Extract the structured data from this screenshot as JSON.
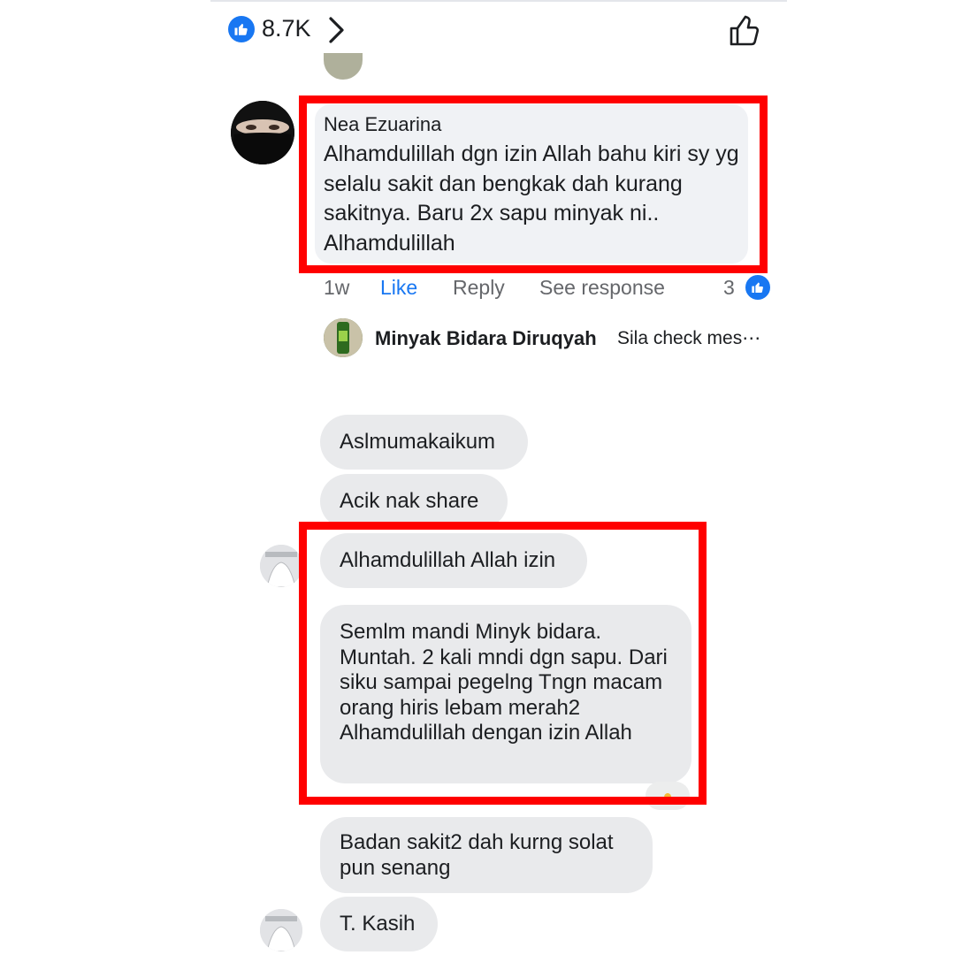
{
  "reactions": {
    "count": "8.7K",
    "icons": {
      "badge": "like-thumb-icon",
      "chevron": "chevron-right-icon",
      "action": "thumbs-up-outline-icon"
    }
  },
  "comment": {
    "author": "Nea Ezuarina",
    "text": "Alhamdulillah dgn izin Allah bahu kiri sy yg selalu sakit dan bengkak dah kurang sakitnya. Baru 2x sapu minyak ni.. Alhamdulillah",
    "time": "1w",
    "like_label": "Like",
    "reply_label": "Reply",
    "see_response_label": "See response",
    "reaction_count": "3"
  },
  "reply": {
    "author": "Minyak Bidara Diruqyah",
    "text": "Sila check mes⋯"
  },
  "messages": [
    "Aslmumakaikum",
    "Acik nak share",
    "Alhamdulillah Allah izin",
    "Semlm mandi Minyk bidara. Muntah. 2 kali mndi dgn sapu. Dari siku sampai pegelng Tngn macam orang hiris lebam merah2 Alhamdulillah dengan izin Allah",
    "Badan sakit2 dah kurng solat pun senang",
    "T. Kasih"
  ],
  "colors": {
    "accent": "#1877f2",
    "highlight": "#ff0000",
    "bubble": "#e9eaec",
    "comment_bubble": "#f0f2f5",
    "secondary_text": "#65676b"
  }
}
